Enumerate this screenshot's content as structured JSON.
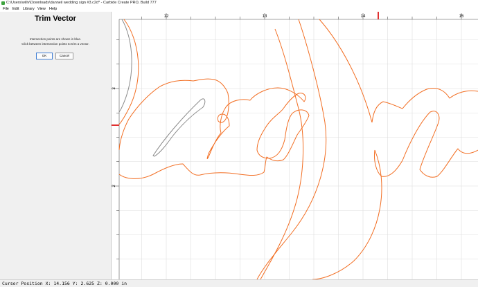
{
  "window": {
    "title": "C:\\Users\\willv\\Downloads\\danneil wedding sign #3.c2d* - Carbide Create PRO, Build 777"
  },
  "menu": [
    "File",
    "Edit",
    "Library",
    "View",
    "Help"
  ],
  "panel": {
    "title": "Trim Vector",
    "instruction_1": "Intersection points are shown in blue.",
    "instruction_2": "Click between intersection points to trim a vector.",
    "ok_label": "OK",
    "cancel_label": "Cancel"
  },
  "rulers": {
    "top_labels": [
      "12",
      "13",
      "14",
      "15"
    ],
    "left_labels": [
      "3",
      "2"
    ]
  },
  "colors": {
    "vector": "#f26d21",
    "selected_vector": "#8a8a8a",
    "cursor_marker": "#e03030",
    "grid": "#dedede"
  },
  "status": {
    "cursor_label": "Cursor Position",
    "x": "14.156",
    "y": "2.625",
    "z": "0.000",
    "units": "in"
  }
}
